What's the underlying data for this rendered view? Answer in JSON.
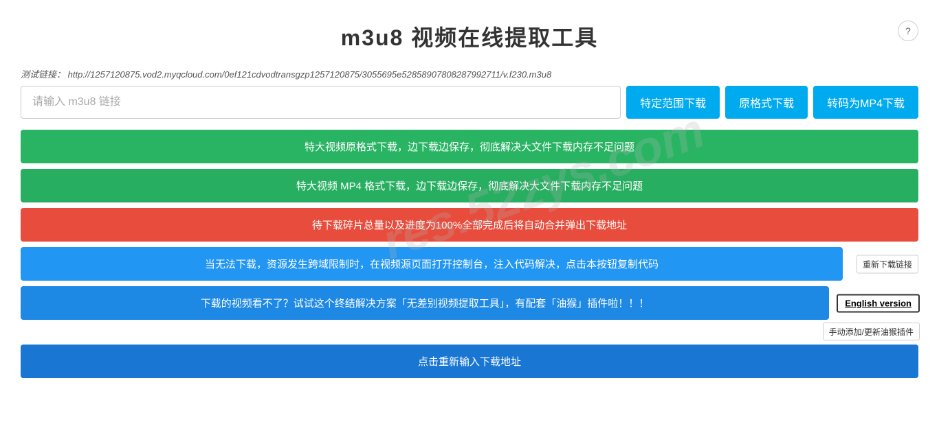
{
  "header": {
    "title": "m3u8 视频在线提取工具",
    "help_label": "?"
  },
  "test_link": {
    "label": "测试链接：",
    "url": "http://1257120875.vod2.myqcloud.com/0ef121cdvodtransgzp1257120875/3055695e52858907808287992711/v.f230.m3u8"
  },
  "input": {
    "placeholder": "请输入 m3u8 链接"
  },
  "buttons": {
    "range_download": "特定范围下载",
    "original_download": "原格式下载",
    "mp4_download": "转码为MP4下载"
  },
  "bars": [
    {
      "id": "bar1",
      "text": "特大视频原格式下载，边下载边保存，彻底解决大文件下载内存不足问题",
      "color": "green",
      "extra": null
    },
    {
      "id": "bar2",
      "text": "特大视频 MP4 格式下载，边下载边保存，彻底解决大文件下载内存不足问题",
      "color": "green2",
      "extra": null
    },
    {
      "id": "bar3",
      "text": "待下载碎片总量以及进度为100%全部完成后将自动合并弹出下载地址",
      "color": "red",
      "extra": null
    },
    {
      "id": "bar4",
      "text": "当无法下载，资源发生跨域限制时，在视频源页面打开控制台，注入代码解决，点击本按钮复制代码",
      "color": "blue",
      "extra": "reload",
      "reload_label": "重新下载链接"
    },
    {
      "id": "bar5",
      "text": "下载的视频看不了？试试这个终结解决方案「无差别视频提取工具」，有配套「油猴」插件啦！！！",
      "color": "blue2",
      "extra": "english",
      "english_label": "English version",
      "plugin_label": "手动添加/更新油猴插件"
    },
    {
      "id": "bar6",
      "text": "点击重新输入下载地址",
      "color": "blue3",
      "extra": null
    }
  ],
  "watermark": {
    "text": "res.52zys.com"
  }
}
